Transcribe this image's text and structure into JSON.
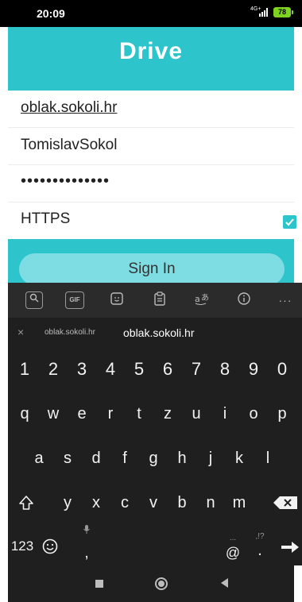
{
  "status": {
    "time": "20:09",
    "network": "4G+",
    "battery": "78"
  },
  "header": {
    "title": "Drive"
  },
  "form": {
    "server": "oblak.sokoli.hr",
    "username": "TomislavSokol",
    "password": "••••••••••••••",
    "https_label": "HTTPS",
    "https_checked": true,
    "sign_in_label": "Sign In"
  },
  "keyboard": {
    "toolbar_icons": [
      "search-icon",
      "gif-icon",
      "sticker-icon",
      "clipboard-icon",
      "translate-icon",
      "info-icon",
      "more-icon"
    ],
    "gif_label": "GIF",
    "suggestions": {
      "close": "×",
      "left": "oblak.sokoli.hr",
      "center": "oblak.sokoli.hr"
    },
    "numbers": [
      "1",
      "2",
      "3",
      "4",
      "5",
      "6",
      "7",
      "8",
      "9",
      "0"
    ],
    "row1": [
      "q",
      "w",
      "e",
      "r",
      "t",
      "z",
      "u",
      "i",
      "o",
      "p"
    ],
    "row2": [
      "a",
      "s",
      "d",
      "f",
      "g",
      "h",
      "j",
      "k",
      "l"
    ],
    "row3": [
      "y",
      "x",
      "c",
      "v",
      "b",
      "n",
      "m"
    ],
    "bottom": {
      "numbers_key": "123",
      "comma": ",",
      "at": "@",
      "period": ".",
      "period_hint": ",!?",
      "at_hint": "..."
    }
  }
}
